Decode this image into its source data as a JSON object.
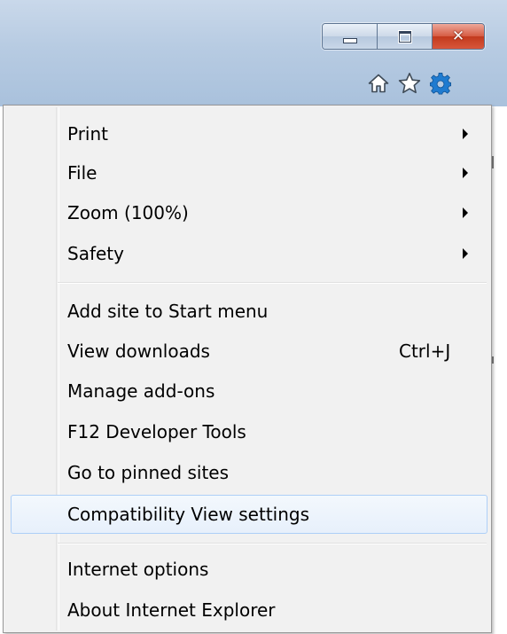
{
  "window": {
    "minimize_glyph": "minimize-icon",
    "maximize_glyph": "maximize-icon",
    "close_glyph": "close-icon"
  },
  "toolbar": {
    "icons": [
      "home-icon",
      "star-icon",
      "gear-icon"
    ]
  },
  "colors": {
    "chrome": "#b7cbe2",
    "close_button": "#c8432a",
    "gear": "#1f7bd0",
    "highlight_border": "#aecff7",
    "highlight_fill": "#e9f2fc"
  },
  "menu": {
    "sections": [
      {
        "items": [
          {
            "label": "Print",
            "submenu": true
          },
          {
            "label": "File",
            "submenu": true
          },
          {
            "label": "Zoom (100%)",
            "submenu": true
          },
          {
            "label": "Safety",
            "submenu": true
          }
        ]
      },
      {
        "items": [
          {
            "label": "Add site to Start menu"
          },
          {
            "label": "View downloads",
            "shortcut": "Ctrl+J"
          },
          {
            "label": "Manage add-ons"
          },
          {
            "label": "F12 Developer Tools"
          },
          {
            "label": "Go to pinned sites"
          },
          {
            "label": "Compatibility View settings",
            "highlighted": true
          }
        ]
      },
      {
        "items": [
          {
            "label": "Internet options"
          },
          {
            "label": "About Internet Explorer"
          }
        ]
      }
    ]
  }
}
